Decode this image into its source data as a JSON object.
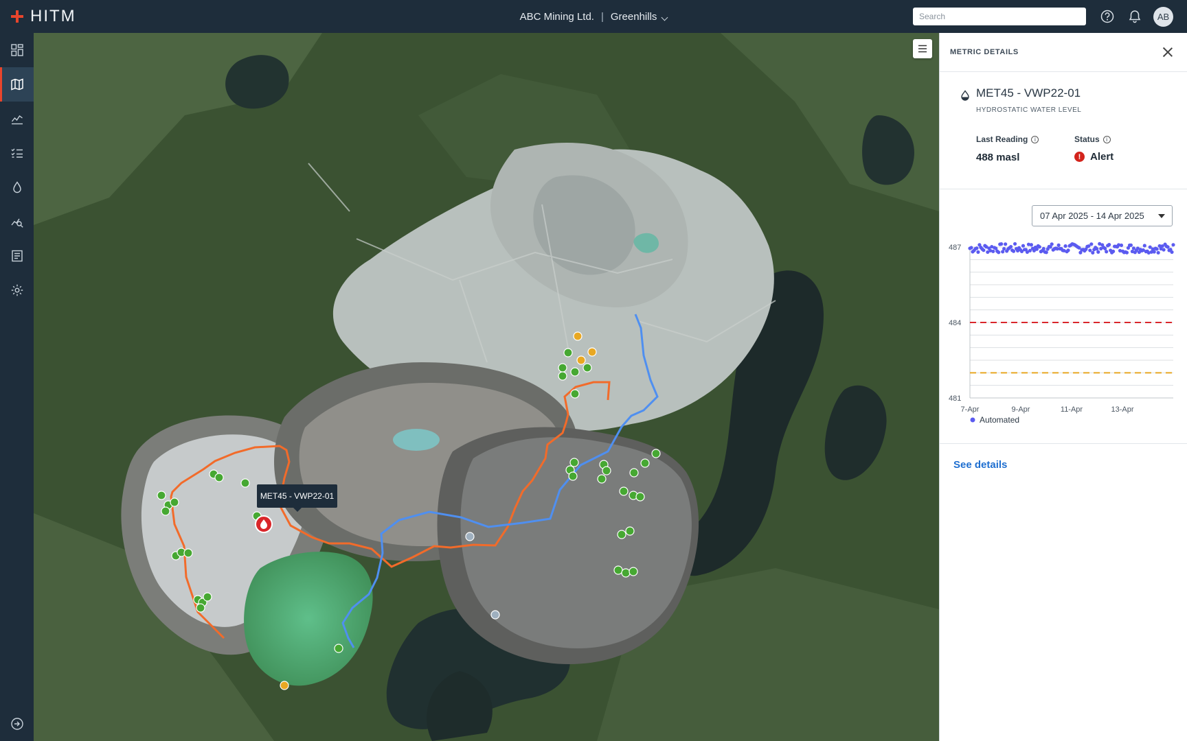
{
  "app": {
    "name": "HITM"
  },
  "header": {
    "organization": "ABC Mining Ltd.",
    "separator": "|",
    "site": "Greenhills",
    "search_placeholder": "Search",
    "avatar_initials": "AB",
    "icons": [
      "help-icon",
      "bell-icon"
    ]
  },
  "nav": {
    "items": [
      "dashboard-icon",
      "map-icon",
      "chart-icon",
      "checklist-icon",
      "water-drop-icon",
      "analysis-icon",
      "reports-icon",
      "settings-icon"
    ],
    "active": "map-icon",
    "footer_icon": "expand-icon"
  },
  "map": {
    "tooltip": "MET45 - VWP22-01",
    "colors": {
      "boundary_orange": "#f26b2a",
      "boundary_blue": "#4f8ff0",
      "marker_green": "#46a832",
      "marker_yellow": "#e8a823",
      "marker_alert": "#d9262a",
      "marker_grey": "#9fb0bf"
    }
  },
  "panel": {
    "title": "METRIC DETAILS",
    "metric_name": "MET45 - VWP22-01",
    "metric_type": "HYDROSTATIC WATER LEVEL",
    "last_reading_label": "Last Reading",
    "last_reading_value": "488 masl",
    "status_label": "Status",
    "status_value": "Alert",
    "date_range": "07 Apr 2025 - 14 Apr 2025",
    "see_details": "See details"
  },
  "chart_data": {
    "type": "scatter",
    "y_ticks": [
      "487",
      "484",
      "481"
    ],
    "ylim": [
      481,
      487
    ],
    "x_ticks": [
      "7-Apr",
      "9-Apr",
      "11-Apr",
      "13-Apr"
    ],
    "xlim": [
      7,
      15
    ],
    "series": [
      {
        "name": "Automated",
        "color": "#5b5bf0",
        "mean": 486.95,
        "x_start": 7.0,
        "x_end": 15.0
      }
    ],
    "thresholds": [
      {
        "value": 484.0,
        "color": "#d9262a",
        "style": "dashed"
      },
      {
        "value": 482.0,
        "color": "#e8a823",
        "style": "dashed"
      }
    ],
    "legend": "Automated",
    "grid": true
  }
}
